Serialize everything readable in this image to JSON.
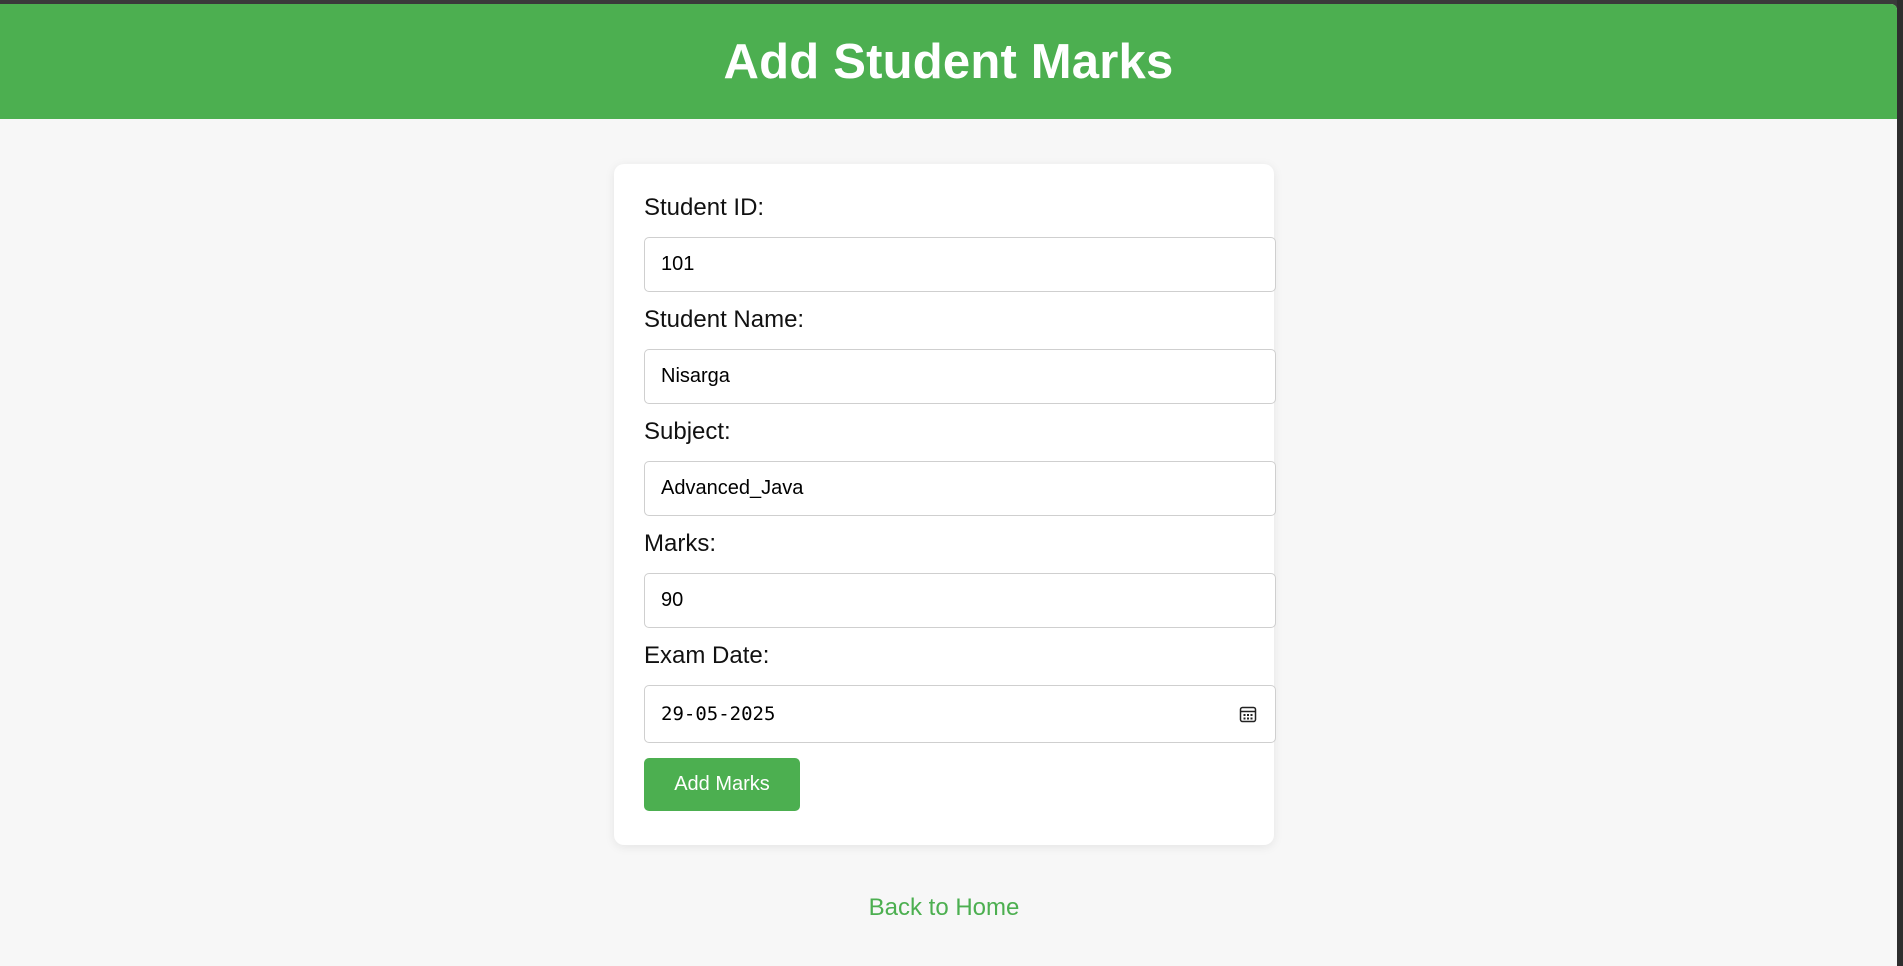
{
  "header": {
    "title": "Add Student Marks"
  },
  "form": {
    "fields": [
      {
        "label": "Student ID:",
        "value": "101"
      },
      {
        "label": "Student Name:",
        "value": "Nisarga"
      },
      {
        "label": "Subject:",
        "value": "Advanced_Java"
      },
      {
        "label": "Marks:",
        "value": "90"
      },
      {
        "label": "Exam Date:",
        "value": "29-05-2025"
      }
    ],
    "submit_label": "Add Marks"
  },
  "footer": {
    "back_link": "Back to Home"
  },
  "colors": {
    "accent": "#4caf50",
    "background": "#f7f7f7"
  },
  "icons": {
    "date_picker": "calendar-icon"
  }
}
